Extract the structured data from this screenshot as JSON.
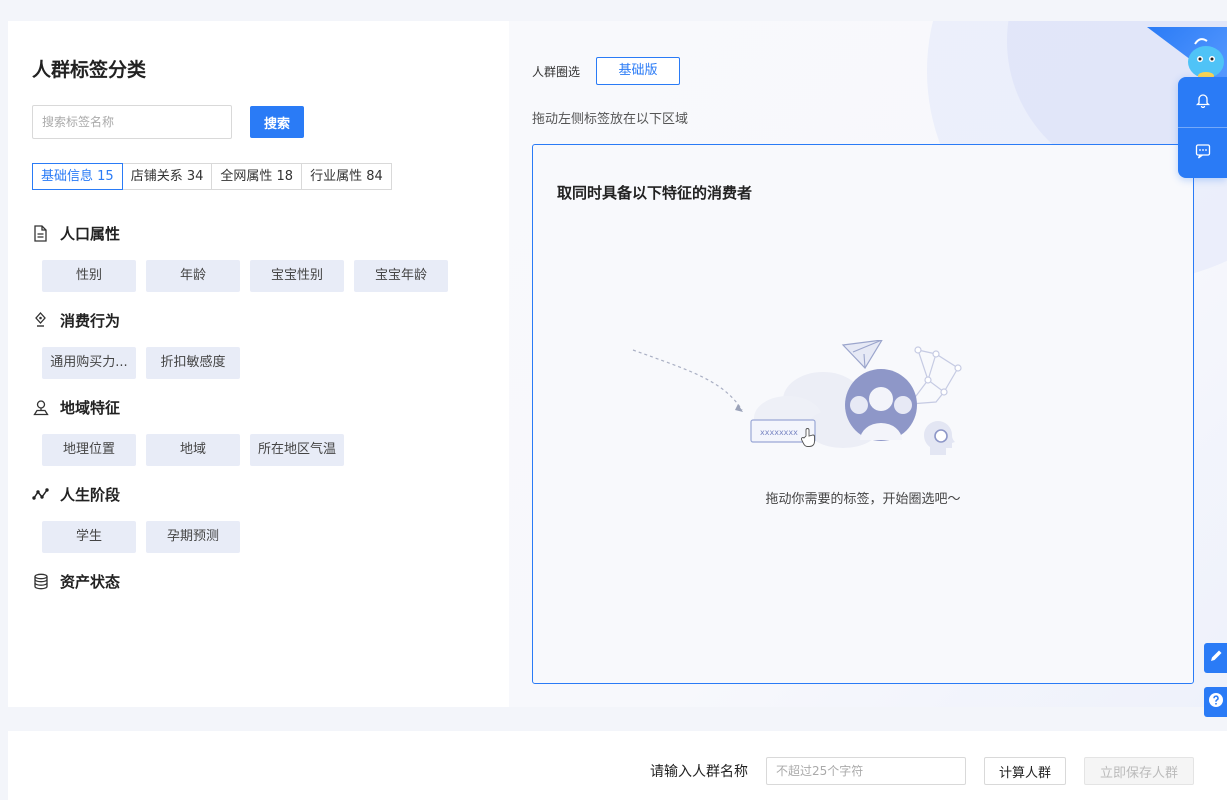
{
  "left": {
    "title": "人群标签分类",
    "search_placeholder": "搜索标签名称",
    "search_button": "搜索",
    "tabs": [
      {
        "label": "基础信息 15",
        "active": true
      },
      {
        "label": "店铺关系 34",
        "active": false
      },
      {
        "label": "全网属性 18",
        "active": false
      },
      {
        "label": "行业属性 84",
        "active": false
      }
    ],
    "sections": [
      {
        "title": "人口属性",
        "icon": "document-icon",
        "chips": [
          "性别",
          "年龄",
          "宝宝性别",
          "宝宝年龄"
        ]
      },
      {
        "title": "消费行为",
        "icon": "pen-icon",
        "chips": [
          "通用购买力...",
          "折扣敏感度"
        ]
      },
      {
        "title": "地域特征",
        "icon": "map-pin-icon",
        "chips": [
          "地理位置",
          "地域",
          "所在地区气温"
        ]
      },
      {
        "title": "人生阶段",
        "icon": "timeline-icon",
        "chips": [
          "学生",
          "孕期预测"
        ]
      },
      {
        "title": "资产状态",
        "icon": "coins-icon",
        "chips": []
      }
    ]
  },
  "right": {
    "selection_label": "人群圈选",
    "version_button": "基础版",
    "drag_hint": "拖动左侧标签放在以下区域",
    "drop_title": "取同时具备以下特征的消费者",
    "empty_text": "拖动你需要的标签，开始圈选吧～",
    "illustration_tag_text": "xxxxxxxx"
  },
  "float": {
    "icons": [
      "bell-icon",
      "chat-icon"
    ],
    "side_icons": [
      "edit-icon",
      "help-icon"
    ]
  },
  "bottom": {
    "name_label": "请输入人群名称",
    "name_placeholder": "不超过25个字符",
    "calc_button": "计算人群",
    "save_button": "立即保存人群"
  },
  "colors": {
    "accent": "#2a7bf6",
    "chip_bg": "#e8ecf7",
    "page_bg": "#f3f5fa"
  }
}
